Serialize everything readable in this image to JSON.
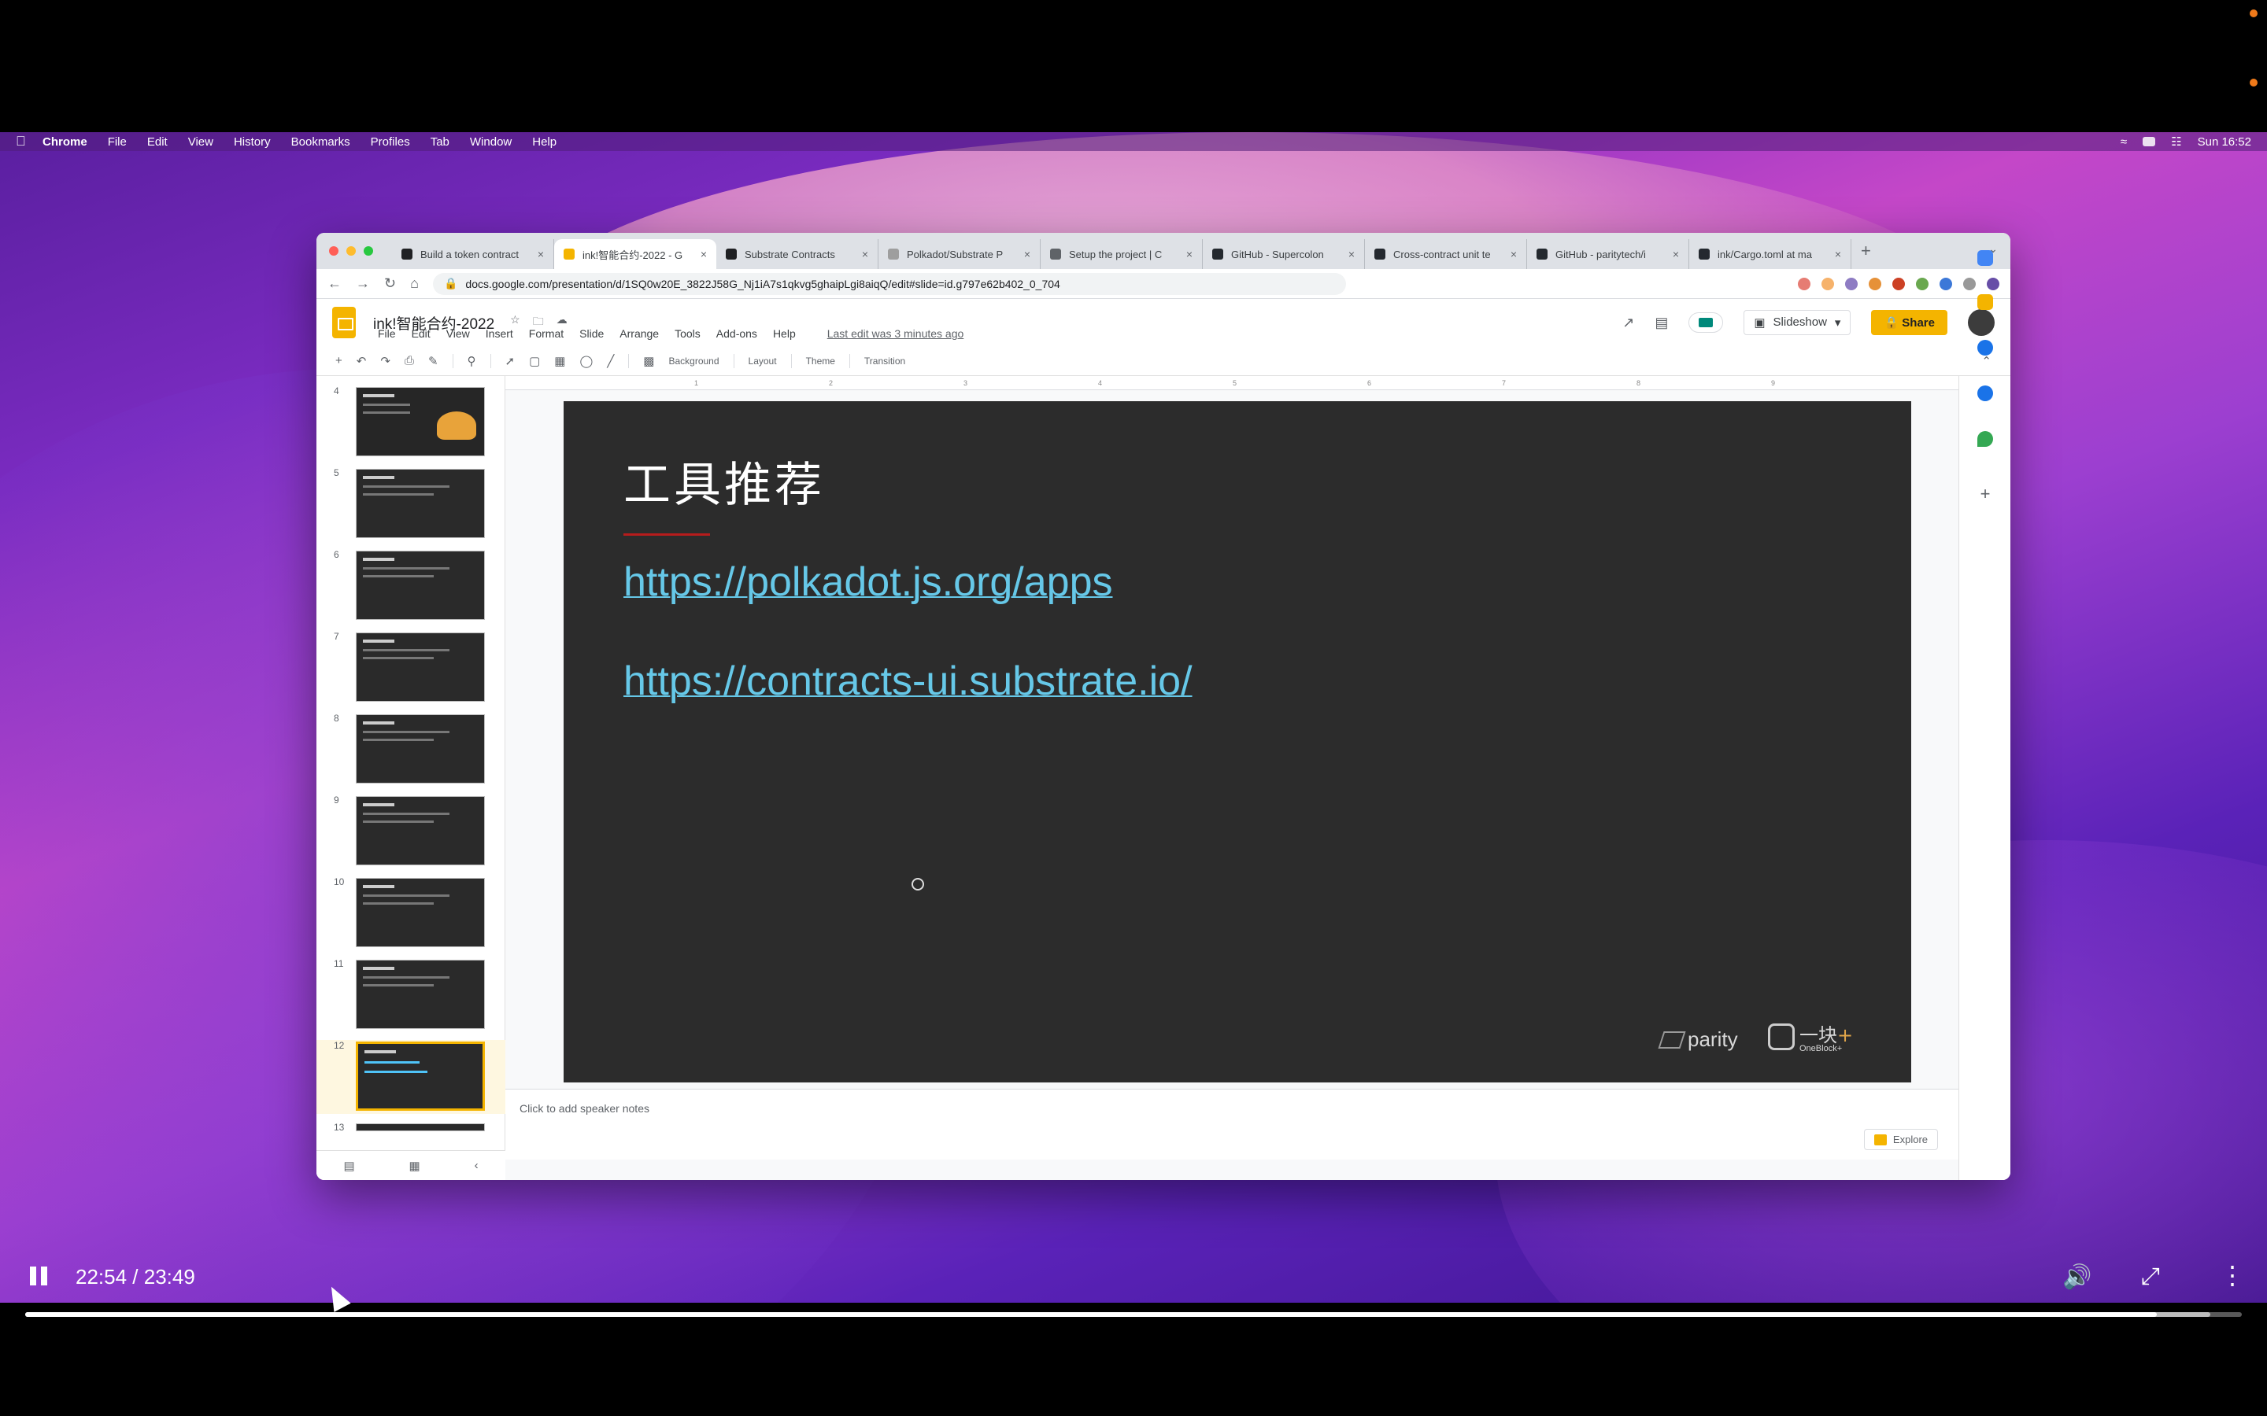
{
  "menubar": {
    "app_name": "Chrome",
    "items": [
      "File",
      "Edit",
      "View",
      "History",
      "Bookmarks",
      "Profiles",
      "Tab",
      "Window",
      "Help"
    ],
    "clock": "Sun 16:52"
  },
  "browser": {
    "tabs": [
      {
        "title": "Build a token contract",
        "active": false,
        "favicon_color": "#202124"
      },
      {
        "title": "ink!智能合约-2022 - G",
        "active": true,
        "favicon_color": "#f4b400"
      },
      {
        "title": "Substrate Contracts",
        "active": false,
        "favicon_color": "#202124"
      },
      {
        "title": "Polkadot/Substrate P",
        "active": false,
        "favicon_color": "#9e9e9e"
      },
      {
        "title": "Setup the project | C",
        "active": false,
        "favicon_color": "#5f6368"
      },
      {
        "title": "GitHub - Supercolon",
        "active": false,
        "favicon_color": "#24292f"
      },
      {
        "title": "Cross-contract unit te",
        "active": false,
        "favicon_color": "#24292f"
      },
      {
        "title": "GitHub - paritytech/i",
        "active": false,
        "favicon_color": "#24292f"
      },
      {
        "title": "ink/Cargo.toml at ma",
        "active": false,
        "favicon_color": "#24292f"
      }
    ],
    "url": "docs.google.com/presentation/d/1SQ0w20E_3822J58G_Nj1iA7s1qkvg5ghaipLgi8aiqQ/edit#slide=id.g797e62b402_0_704"
  },
  "slides_app": {
    "doc_title": "ink!智能合约-2022",
    "menus": [
      "File",
      "Edit",
      "View",
      "Insert",
      "Format",
      "Slide",
      "Arrange",
      "Tools",
      "Add-ons",
      "Help"
    ],
    "last_edit": "Last edit was 3 minutes ago",
    "slideshow_label": "Slideshow",
    "share_label": "Share",
    "toolbar": {
      "background_label": "Background",
      "layout_label": "Layout",
      "theme_label": "Theme",
      "transition_label": "Transition"
    },
    "ruler_ticks": [
      "1",
      "2",
      "3",
      "4",
      "5",
      "6",
      "7",
      "8",
      "9"
    ],
    "filmstrip": {
      "slide_numbers": [
        "4",
        "5",
        "6",
        "7",
        "8",
        "9",
        "10",
        "11",
        "12",
        "13"
      ],
      "selected": "12"
    },
    "current_slide": {
      "title": "工具推荐",
      "links": [
        "https://polkadot.js.org/apps",
        "https://contracts-ui.substrate.io/"
      ],
      "logo_parity": "parity",
      "logo_oneblock_cn": "一块",
      "logo_oneblock_plus": "+",
      "logo_oneblock_en": "OneBlock+"
    },
    "notes_placeholder": "Click to add speaker notes",
    "explore_label": "Explore"
  },
  "player": {
    "time": "22:54 / 23:49",
    "progress_fraction": 0.9617,
    "buffered_fraction": 0.9858
  }
}
